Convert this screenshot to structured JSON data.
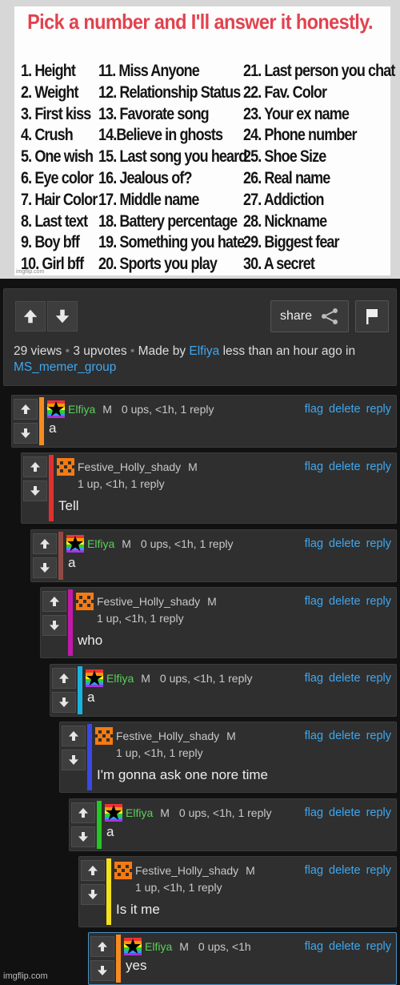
{
  "meme": {
    "title": "Pick a number and I'll answer it honestly.",
    "col1": [
      "1. Height",
      "2. Weight",
      "3. First kiss",
      "4. Crush",
      "5. One wish",
      "6. Eye color",
      "7. Hair Color",
      "8. Last text",
      "9. Boy bff",
      "10. Girl bff"
    ],
    "col2": [
      "11. Miss Anyone",
      "12. Relationship Status",
      "13. Favorate song",
      "14.Believe in ghosts",
      "15. Last song you heard",
      "16. Jealous of?",
      "17. Middle name",
      "18. Battery percentage",
      "19. Something you hate",
      "20. Sports you play"
    ],
    "col3": [
      "21. Last person you chat",
      "22. Fav. Color",
      "23. Your ex name",
      "24. Phone number",
      "25. Shoe Size",
      "26. Real name",
      "27. Addiction",
      "28. Nickname",
      "29. Biggest fear",
      "30. A secret"
    ],
    "watermark": "imgflip.com"
  },
  "post": {
    "share_label": "share",
    "views": "29 views",
    "upvotes": "3 upvotes",
    "made_by_prefix": "Made by",
    "author": "Elfiya",
    "time": "less than an hour ago in",
    "stream": "MS_memer_group"
  },
  "actions": {
    "flag": "flag",
    "delete": "delete",
    "reply": "reply"
  },
  "comments": [
    {
      "user": "Elfiya",
      "badge": "M",
      "stats": "0 ups, <1h, 1 reply",
      "text": "a",
      "color": "#f68b1f"
    },
    {
      "user": "Festive_Holly_shady",
      "badge": "M",
      "stats": "1 up, <1h, 1 reply",
      "text": "Tell",
      "color": "#e03030"
    },
    {
      "user": "Elfiya",
      "badge": "M",
      "stats": "0 ups, <1h, 1 reply",
      "text": "a",
      "color": "#8f4a45"
    },
    {
      "user": "Festive_Holly_shady",
      "badge": "M",
      "stats": "1 up, <1h, 1 reply",
      "text": "who",
      "color": "#c11aa8"
    },
    {
      "user": "Elfiya",
      "badge": "M",
      "stats": "0 ups, <1h, 1 reply",
      "text": "a",
      "color": "#18b4e0"
    },
    {
      "user": "Festive_Holly_shady",
      "badge": "M",
      "stats": "1 up, <1h, 1 reply",
      "text": "I'm gonna ask one nore time",
      "color": "#3a48e8"
    },
    {
      "user": "Elfiya",
      "badge": "M",
      "stats": "0 ups, <1h, 1 reply",
      "text": "a",
      "color": "#25c525"
    },
    {
      "user": "Festive_Holly_shady",
      "badge": "M",
      "stats": "1 up, <1h, 1 reply",
      "text": "Is it me",
      "color": "#f2e11c"
    },
    {
      "user": "Elfiya",
      "badge": "M",
      "stats": "0 ups, <1h",
      "text": "yes",
      "color": "#f68b1f"
    }
  ],
  "footer_watermark": "imgflip.com",
  "icons": [
    "arrow-up-icon",
    "arrow-down-icon",
    "share-icon",
    "flag-icon",
    "rainbow-star-avatar-icon",
    "orange-pixel-avatar-icon"
  ]
}
